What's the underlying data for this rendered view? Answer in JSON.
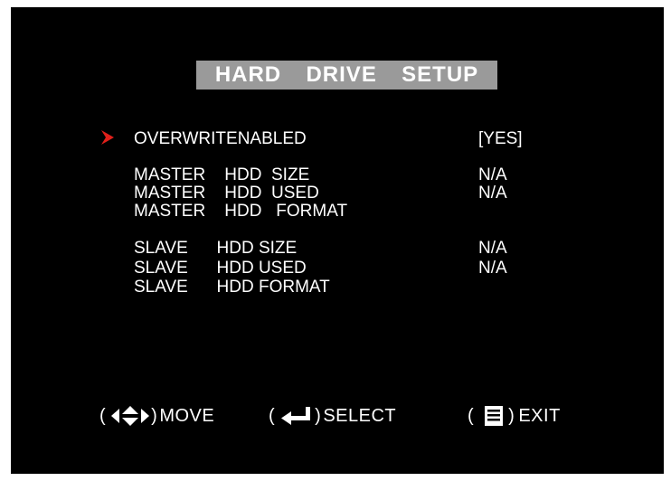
{
  "title": "HARD  DRIVE  SETUP",
  "menu": {
    "selected": {
      "label": "OVERWRITENABLED",
      "value": "[YES]"
    },
    "master": [
      {
        "label": "MASTER    HDD  SIZE",
        "value": "N/A"
      },
      {
        "label": "MASTER    HDD  USED",
        "value": "N/A"
      },
      {
        "label": "MASTER    HDD   FORMAT",
        "value": ""
      }
    ],
    "slave": [
      {
        "label": "SLAVE      HDD SIZE",
        "value": "N/A"
      },
      {
        "label": "SLAVE      HDD USED",
        "value": "N/A"
      },
      {
        "label": "SLAVE      HDD FORMAT",
        "value": ""
      }
    ]
  },
  "footer": {
    "move": {
      "open": "(",
      "close": ")",
      "label": "MOVE",
      "icon": "four-way-arrows-icon"
    },
    "select": {
      "open": "(",
      "close": ")",
      "label": "SELECT",
      "icon": "enter-key-icon"
    },
    "exit": {
      "open": "(",
      "close": ")",
      "label": "EXIT",
      "icon": "menu-icon"
    }
  },
  "colors": {
    "background": "#000000",
    "title_bar": "#9a9a9a",
    "text": "#ffffff",
    "cursor": "#e0201a"
  }
}
